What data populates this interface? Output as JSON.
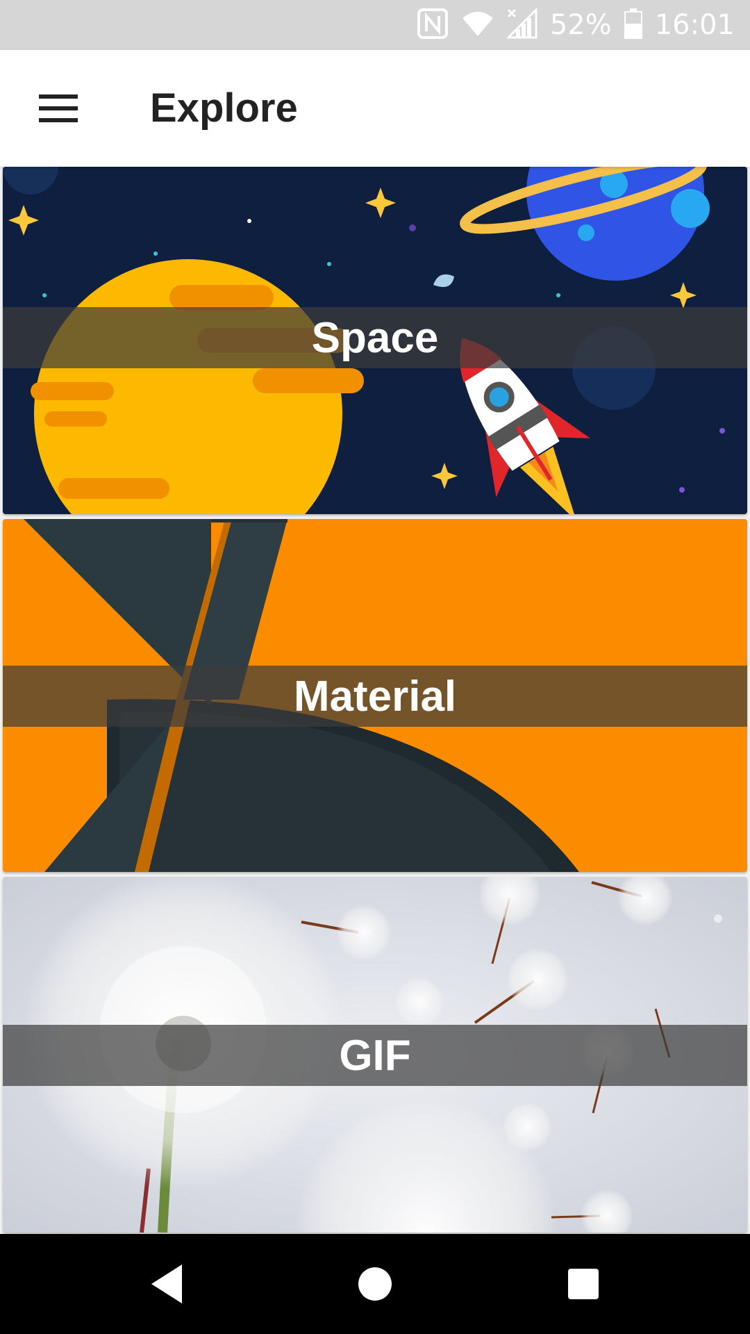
{
  "status_bar": {
    "battery": "52%",
    "time": "16:01",
    "icons": [
      "nfc-icon",
      "wifi-icon",
      "cellular-no-signal-icon",
      "battery-icon"
    ]
  },
  "app_bar": {
    "title": "Explore",
    "menu_icon": "hamburger-menu-icon"
  },
  "categories": [
    {
      "label": "Space"
    },
    {
      "label": "Material"
    },
    {
      "label": "GIF"
    }
  ],
  "nav_bar": {
    "icons": [
      "back-icon",
      "home-icon",
      "recents-icon"
    ]
  },
  "colors": {
    "space_bg": "#0e1f3f",
    "material_orange": "#fb8c00",
    "material_dark": "#263238",
    "label_band": "#3c3c3c"
  }
}
